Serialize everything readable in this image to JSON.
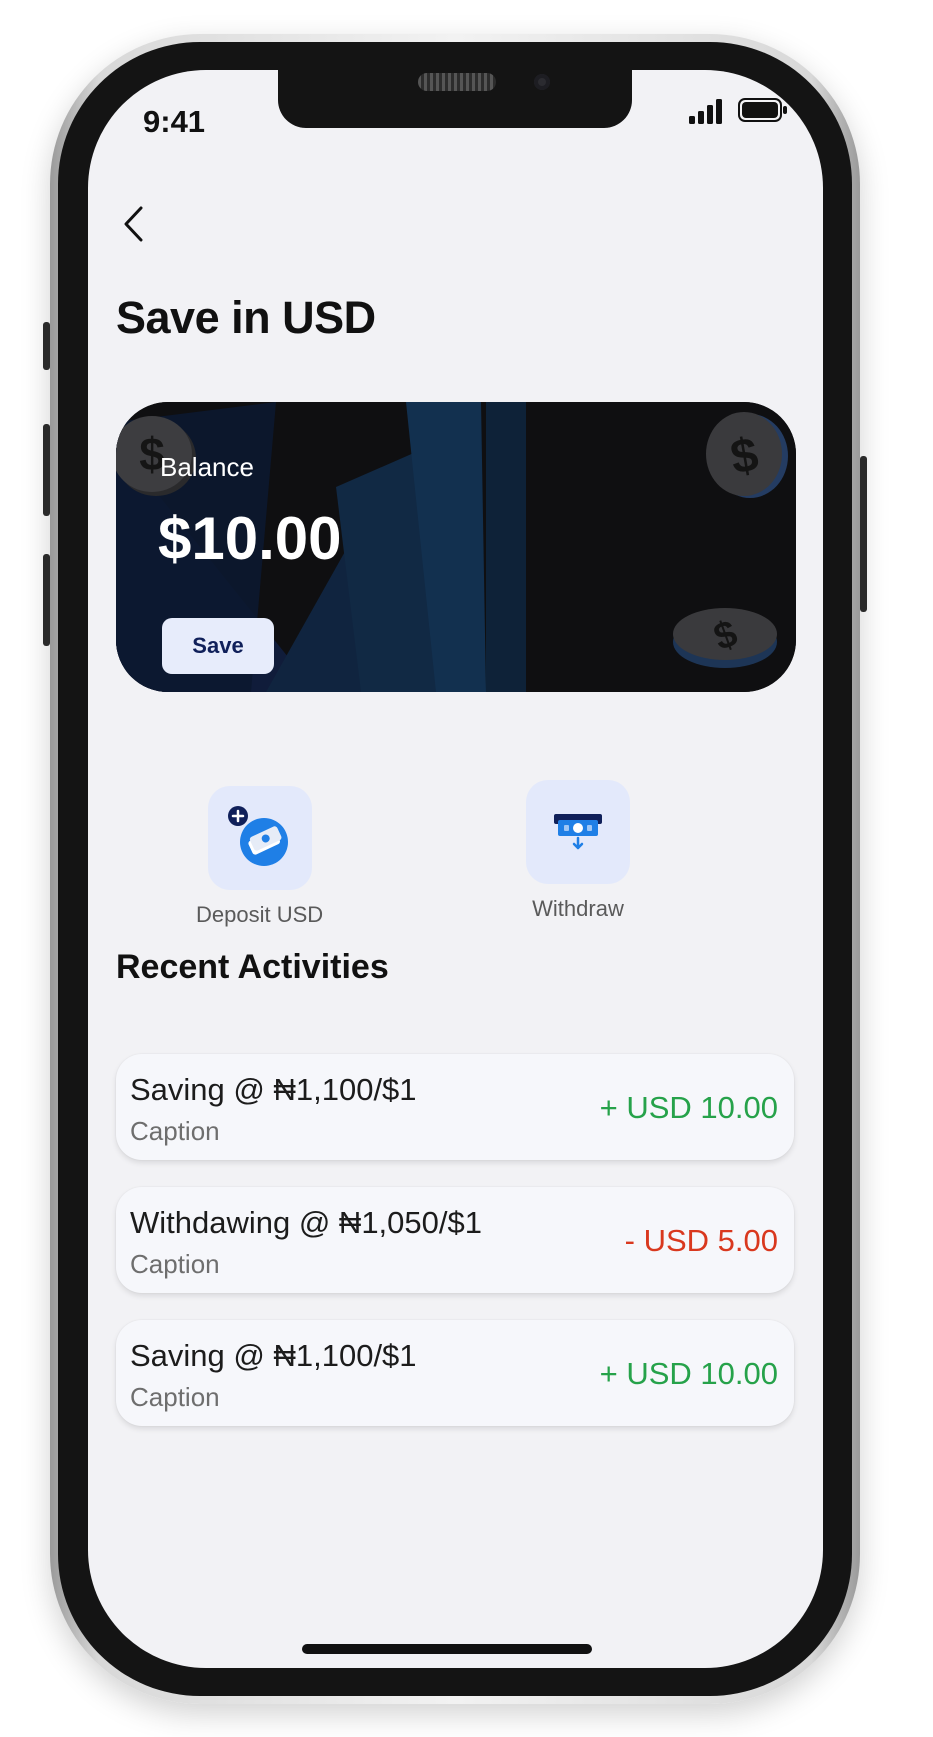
{
  "status_bar": {
    "time": "9:41",
    "signal_icon": "cellular-signal-icon",
    "battery_icon": "battery-icon"
  },
  "header": {
    "back_icon": "chevron-left-icon",
    "title": "Save in USD"
  },
  "balance_card": {
    "label": "Balance",
    "amount": "$10.00",
    "save_label": "Save",
    "decor_icons": [
      "dollar-coin-icon",
      "dollar-coin-icon",
      "dollar-coin-icon"
    ]
  },
  "actions": [
    {
      "label": "Deposit USD",
      "icon": "deposit-cash-icon"
    },
    {
      "label": "Withdraw",
      "icon": "atm-withdraw-icon"
    }
  ],
  "recent": {
    "title": "Recent Activities",
    "items": [
      {
        "title": "Saving @  ₦1,100/$1",
        "caption": "Caption",
        "amount": "+ USD 10.00",
        "direction": "credit"
      },
      {
        "title": "Withdawing @  ₦1,050/$1",
        "caption": "Caption",
        "amount": "- USD 5.00",
        "direction": "debit"
      },
      {
        "title": "Saving @  ₦1,100/$1",
        "caption": "Caption",
        "amount": "+ USD 10.00",
        "direction": "credit"
      }
    ]
  },
  "colors": {
    "brand_blue": "#1f7fe6",
    "navy": "#10205a",
    "card_bg": "#0f0f11",
    "positive": "#26a24a",
    "negative": "#d9381e",
    "screen_bg": "#f2f2f5",
    "action_tile": "#e3e9fb"
  }
}
